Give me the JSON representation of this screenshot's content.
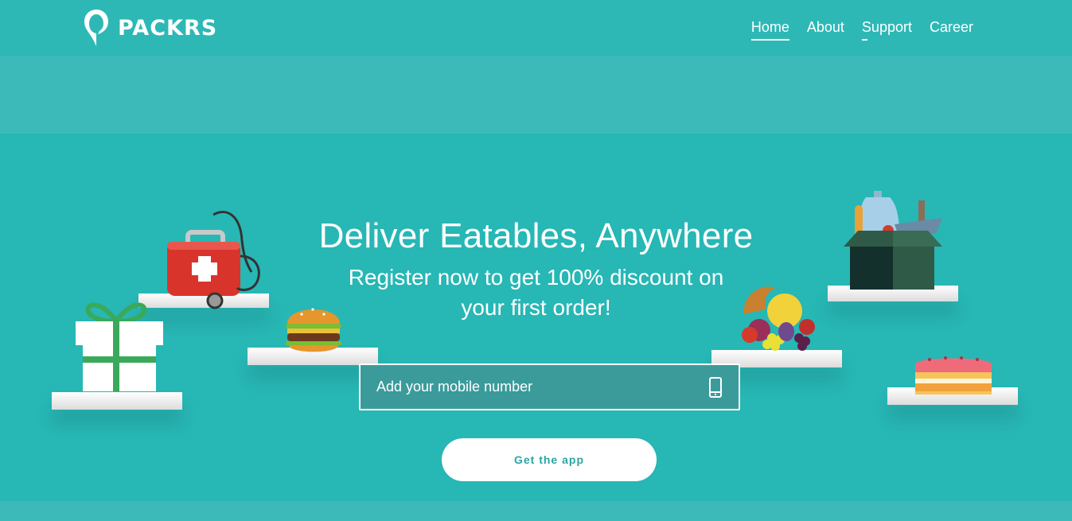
{
  "brand": {
    "name": "PACKRS",
    "accent": "#27b7b5"
  },
  "nav": {
    "items": [
      {
        "label": "Home",
        "active": true
      },
      {
        "label": "About",
        "active": false
      },
      {
        "label": "Support",
        "active": false
      },
      {
        "label": "Career",
        "active": false
      }
    ]
  },
  "hero": {
    "title": "Deliver Eatables, Anywhere",
    "subtitle_line1": "Register now to get 100% discount on",
    "subtitle_line2": "your first order!"
  },
  "form": {
    "mobile_placeholder": "Add your mobile number",
    "mobile_icon": "smartphone-icon",
    "cta_label": "Get the app"
  },
  "illustrations": [
    "gift-box",
    "first-aid-kit",
    "burger",
    "fruit-cornucopia",
    "grocery-box",
    "cake"
  ]
}
